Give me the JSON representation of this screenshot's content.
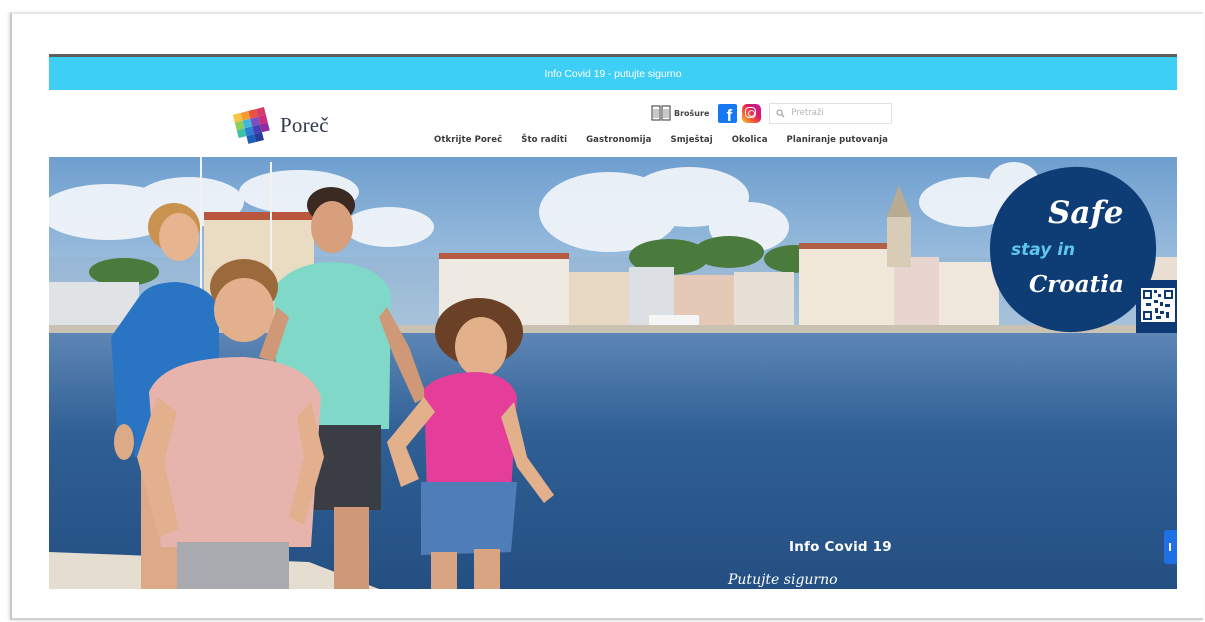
{
  "covid_bar": {
    "text": "Info Covid 19 - putujte sigurno"
  },
  "logo": {
    "text": "Poreč"
  },
  "utility": {
    "brochure_label": "Brošure",
    "facebook_label": "f",
    "search_placeholder": "Pretraži"
  },
  "nav": {
    "items": [
      {
        "label": "Otkrijte Poreč"
      },
      {
        "label": "Što raditi"
      },
      {
        "label": "Gastronomija"
      },
      {
        "label": "Smještaj"
      },
      {
        "label": "Okolica"
      },
      {
        "label": "Planiranje putovanja"
      }
    ]
  },
  "hero": {
    "badge": {
      "safe": "Safe",
      "stay": "stay in",
      "croatia": "Croatia"
    },
    "info_title": "Info Covid 19",
    "info_subtitle": "Putujte sigurno"
  },
  "colors": {
    "covid_bar": "#3dcff5",
    "facebook": "#1877f2",
    "badge_navy": "#0e3c74",
    "badge_accent": "#5fc6ee",
    "nav_text": "#3b3b3b",
    "side_tab": "#1f6fe5"
  },
  "icons": {
    "brochure": "book-icon",
    "facebook": "facebook-icon",
    "instagram": "instagram-icon",
    "search": "search-icon",
    "side_tab": "side-tab-icon"
  }
}
